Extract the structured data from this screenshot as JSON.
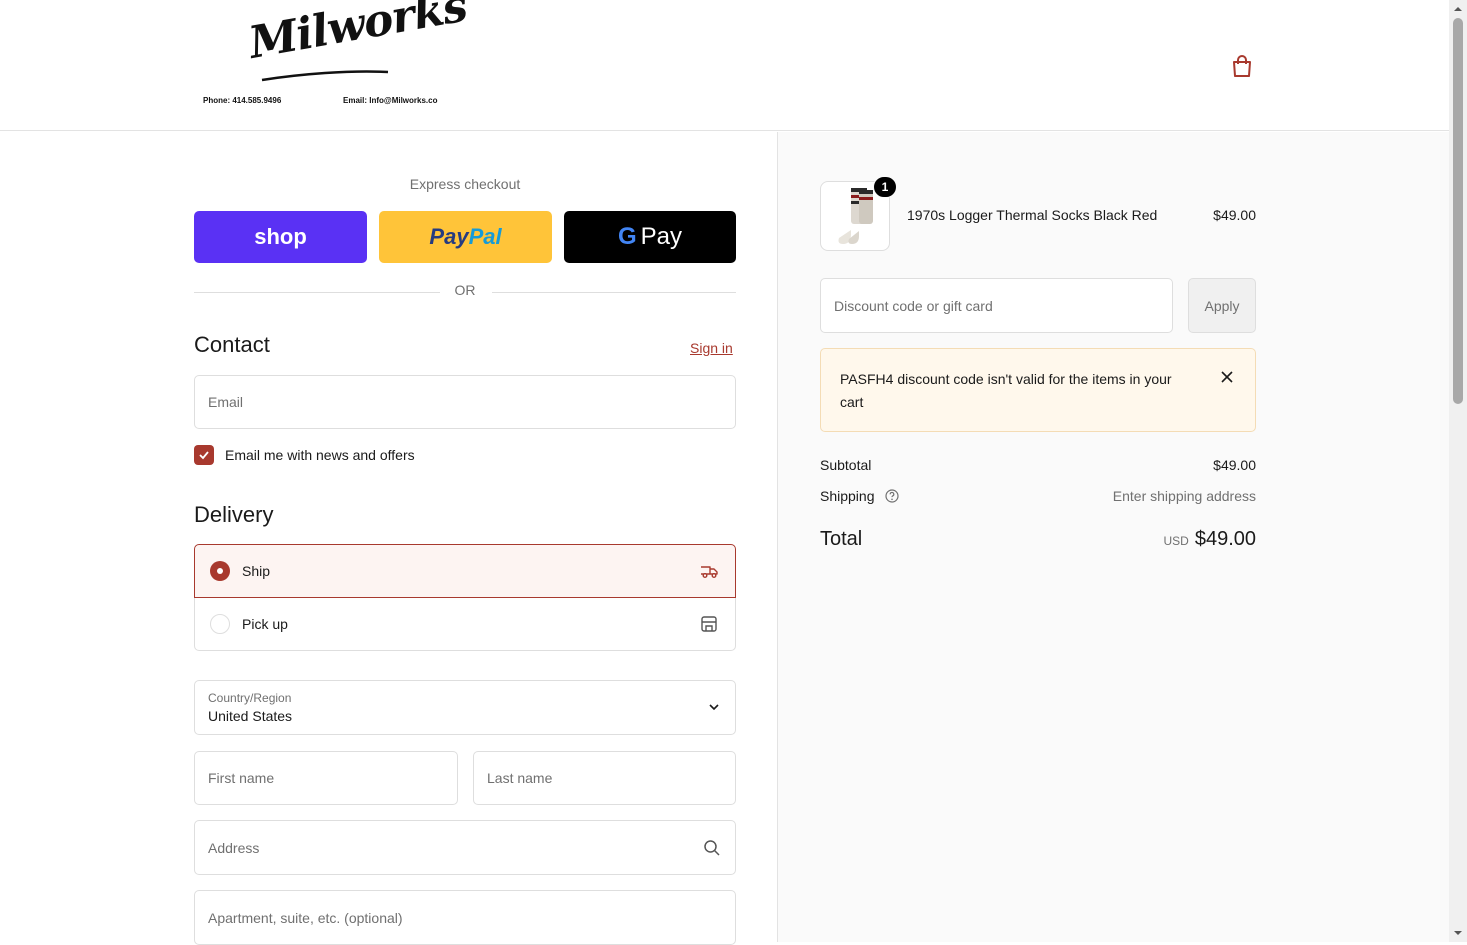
{
  "header": {
    "logo_text": "Milworks",
    "phone": "Phone: 414.585.9496",
    "email": "Email: Info@Milworks.co"
  },
  "express": {
    "label": "Express checkout",
    "shop_label": "shop",
    "paypal_part1": "Pay",
    "paypal_part2": "Pal",
    "gpay_g": "G",
    "gpay_label": "Pay",
    "or_label": "OR"
  },
  "contact": {
    "title": "Contact",
    "sign_in": "Sign in",
    "email_placeholder": "Email",
    "newsletter_label": "Email me with news and offers",
    "newsletter_checked": true
  },
  "delivery": {
    "title": "Delivery",
    "options": [
      {
        "label": "Ship",
        "selected": true
      },
      {
        "label": "Pick up",
        "selected": false
      }
    ],
    "country_label": "Country/Region",
    "country_value": "United States",
    "first_name_placeholder": "First name",
    "last_name_placeholder": "Last name",
    "address_placeholder": "Address",
    "apartment_placeholder": "Apartment, suite, etc. (optional)"
  },
  "summary": {
    "product": {
      "name": "1970s Logger Thermal Socks Black Red",
      "price": "$49.00",
      "quantity": "1"
    },
    "discount_placeholder": "Discount code or gift card",
    "apply_label": "Apply",
    "error_message": "PASFH4 discount code isn't valid for the items in your cart",
    "subtotal_label": "Subtotal",
    "subtotal_value": "$49.00",
    "shipping_label": "Shipping",
    "shipping_value": "Enter shipping address",
    "total_label": "Total",
    "total_currency": "USD",
    "total_value": "$49.00"
  },
  "colors": {
    "accent": "#a8392e",
    "shop": "#5a31f4",
    "paypal": "#ffc439",
    "gpay": "#000000"
  }
}
